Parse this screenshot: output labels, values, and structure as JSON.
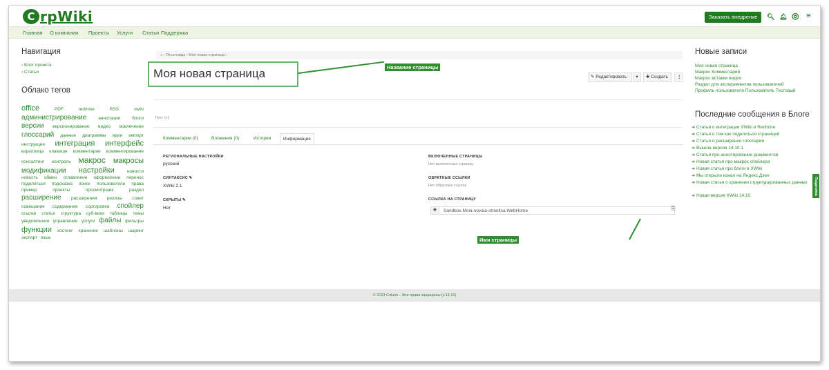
{
  "header": {
    "logo_letter": "C",
    "logo_text": "rpWiki",
    "order_button": "Заказать внедрение",
    "icons": [
      "search-icon",
      "bell-icon",
      "user-icon",
      "menu-icon"
    ]
  },
  "nav": {
    "items": [
      "Главная",
      "О компании",
      "Проекты",
      "Услуги",
      "Статьи",
      "Поддержка"
    ]
  },
  "left": {
    "nav_title": "Навигация",
    "nav_links": [
      "› Блог проекта",
      "› Статьи"
    ],
    "tags_title": "Облако тегов",
    "tags": [
      {
        "t": "office",
        "s": 11
      },
      {
        "t": "PDF",
        "s": 6.5
      },
      {
        "t": "redmine",
        "s": 6.5
      },
      {
        "t": "RSS",
        "s": 6.5
      },
      {
        "t": "xwiki",
        "s": 6.5
      },
      {
        "t": "администрирование",
        "s": 10
      },
      {
        "t": "аннотации",
        "s": 6.5
      },
      {
        "t": "блоги",
        "s": 6.5
      },
      {
        "t": "версии",
        "s": 10
      },
      {
        "t": "версионирование",
        "s": 6.5
      },
      {
        "t": "видео",
        "s": 6.5
      },
      {
        "t": "вовлечение",
        "s": 6.5
      },
      {
        "t": "глоссарий",
        "s": 10
      },
      {
        "t": "данные",
        "s": 6.5
      },
      {
        "t": "диаграммы",
        "s": 6.5
      },
      {
        "t": "идеи",
        "s": 6.5
      },
      {
        "t": "импорт",
        "s": 6.5
      },
      {
        "t": "инструкция",
        "s": 6.5
      },
      {
        "t": "интеграция",
        "s": 11
      },
      {
        "t": "интерфейс",
        "s": 11
      },
      {
        "t": "кириллица",
        "s": 6.5
      },
      {
        "t": "клавиши",
        "s": 6.5
      },
      {
        "t": "комментарии",
        "s": 6.5
      },
      {
        "t": "комментирование",
        "s": 6.5
      },
      {
        "t": "консалтинг",
        "s": 6.5
      },
      {
        "t": "контроль",
        "s": 6.5
      },
      {
        "t": "макрос",
        "s": 12
      },
      {
        "t": "макросы",
        "s": 11
      },
      {
        "t": "модификации",
        "s": 10
      },
      {
        "t": "настройки",
        "s": 11
      },
      {
        "t": "новости",
        "s": 6.5
      },
      {
        "t": "новость",
        "s": 6.5
      },
      {
        "t": "обмен",
        "s": 6.5
      },
      {
        "t": "оглавление",
        "s": 6.5
      },
      {
        "t": "оформление",
        "s": 6.5
      },
      {
        "t": "перенос",
        "s": 6.5
      },
      {
        "t": "поделиться",
        "s": 6.5
      },
      {
        "t": "подсказка",
        "s": 6.5
      },
      {
        "t": "поиск",
        "s": 6.5
      },
      {
        "t": "пользователи",
        "s": 6.5
      },
      {
        "t": "права",
        "s": 6.5
      },
      {
        "t": "пример",
        "s": 6.5
      },
      {
        "t": "проекты",
        "s": 6.5
      },
      {
        "t": "просмотрщик",
        "s": 6.5
      },
      {
        "t": "раздел",
        "s": 6.5
      },
      {
        "t": "расширение",
        "s": 10
      },
      {
        "t": "расширения",
        "s": 6.5
      },
      {
        "t": "релизы",
        "s": 6.5
      },
      {
        "t": "совет",
        "s": 6.5
      },
      {
        "t": "совещание",
        "s": 6.5
      },
      {
        "t": "содержание",
        "s": 6.5
      },
      {
        "t": "сортировка",
        "s": 6.5
      },
      {
        "t": "спойлер",
        "s": 10
      },
      {
        "t": "ссылки",
        "s": 6.5
      },
      {
        "t": "статья",
        "s": 6.5
      },
      {
        "t": "структура",
        "s": 6.5
      },
      {
        "t": "суб-вики",
        "s": 6.5
      },
      {
        "t": "таблицы",
        "s": 6.5
      },
      {
        "t": "темы",
        "s": 6.5
      },
      {
        "t": "уведомления",
        "s": 6.5
      },
      {
        "t": "управление",
        "s": 6.5
      },
      {
        "t": "услуги",
        "s": 6.5
      },
      {
        "t": "файлы",
        "s": 10
      },
      {
        "t": "фильтры",
        "s": 6.5
      },
      {
        "t": "функции",
        "s": 11
      },
      {
        "t": "хостинг",
        "s": 6.5
      },
      {
        "t": "хранение",
        "s": 6.5
      },
      {
        "t": "шаблоны",
        "s": 6.5
      },
      {
        "t": "шаринг",
        "s": 6.5
      },
      {
        "t": "экспорт",
        "s": 6.5
      },
      {
        "t": "язык",
        "s": 6.5
      }
    ]
  },
  "main": {
    "breadcrumb": "⌂ ›  Песочница ›  Моя новая страница ›",
    "title": "Моя новая страница",
    "callout_title": "Название страницы",
    "callout_name": "Имя страницы",
    "edit_button": "✎ Редактировать",
    "dropdown_button": "▾",
    "create_button": "✚ Создать",
    "more_button": "⋮",
    "tags_label": "Теги: [+]",
    "tabs": [
      "Комментарии (0)",
      "Вложения (0)",
      "История",
      "Информация"
    ],
    "info": {
      "regional_h": "РЕГИОНАЛЬНЫЕ НАСТРОЙКИ",
      "regional_v": "русский",
      "syntax_h": "СИНТАКСИС ✎",
      "syntax_v": "XWiki 2.1",
      "hidden_h": "СКРЫТЫ ✎",
      "hidden_v": "Нет",
      "included_h": "ВКЛЮЧЕННЫЕ СТРАНИЦЫ",
      "included_v": "Нет включенных страниц",
      "backlinks_h": "ОБРАТНЫЕ ССЫЛКИ",
      "backlinks_v": "Нет обратных ссылок",
      "link_h": "ССЫЛКА НА СТРАНИЦУ",
      "link_v": "Sandbox.Moia-novaia-stranitsa.WebHome"
    }
  },
  "right": {
    "recent_title": "Новые записи",
    "recent": [
      "Моя новая страница",
      "Макрос Комментарий",
      "Макрос вставки видео",
      "Раздел для экспериментов пользователей",
      "Профиль пользователя Пользователь Тестовый"
    ],
    "blog_title": "Последние сообщения в Блоге",
    "blog": [
      "Статья о интеграции XWiki и Redmine",
      "Статья о том как поделиться страницей",
      "Статья о расширении глоссария",
      "Вышла версия 14.10.1",
      "Статья про аннотирование документов",
      "Новая статья про макрос спойлера",
      "Новая статья про блоги в XWiki",
      "Мы открыли канал на Яндекс.Дзен",
      "Новая статья о хранении структурированных данных",
      "Новая версия XWiki 14.10"
    ],
    "feedback": "Поддержка"
  },
  "footer": {
    "text": "© 2023 Coluns – Все права защищены (v.14.10)"
  }
}
